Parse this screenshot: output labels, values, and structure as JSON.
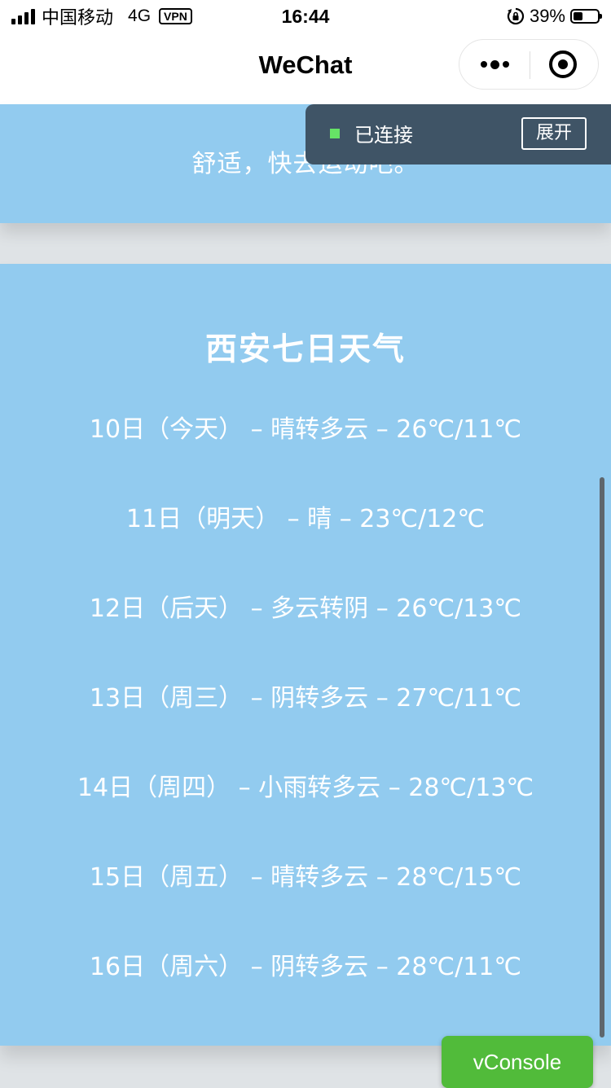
{
  "status_bar": {
    "carrier": "中国移动",
    "network": "4G",
    "vpn": "VPN",
    "time": "16:44",
    "battery_percent": "39%",
    "battery_level": 0.39
  },
  "nav": {
    "title": "WeChat",
    "icons": [
      "more-icon",
      "close-miniprogram-icon"
    ]
  },
  "tip": {
    "text": "舒适，快去运动吧。"
  },
  "forecast": {
    "title": "西安七日天气",
    "days": [
      "10日（今天） – 晴转多云 – 26℃/11℃",
      "11日（明天） – 晴 – 23℃/12℃",
      "12日（后天） – 多云转阴 – 26℃/13℃",
      "13日（周三） – 阴转多云 – 27℃/11℃",
      "14日（周四） – 小雨转多云 – 28℃/13℃",
      "15日（周五） – 晴转多云 – 28℃/15℃",
      "16日（周六） – 阴转多云 – 28℃/11℃"
    ]
  },
  "vconsole": {
    "status": "已连接",
    "expand_label": "展开",
    "button_label": "vConsole",
    "status_color": "#66e366",
    "button_color": "#51bb3a"
  },
  "colors": {
    "card_background": "#92cbef",
    "page_background": "#dfe3e6",
    "text": "#ffffff"
  }
}
